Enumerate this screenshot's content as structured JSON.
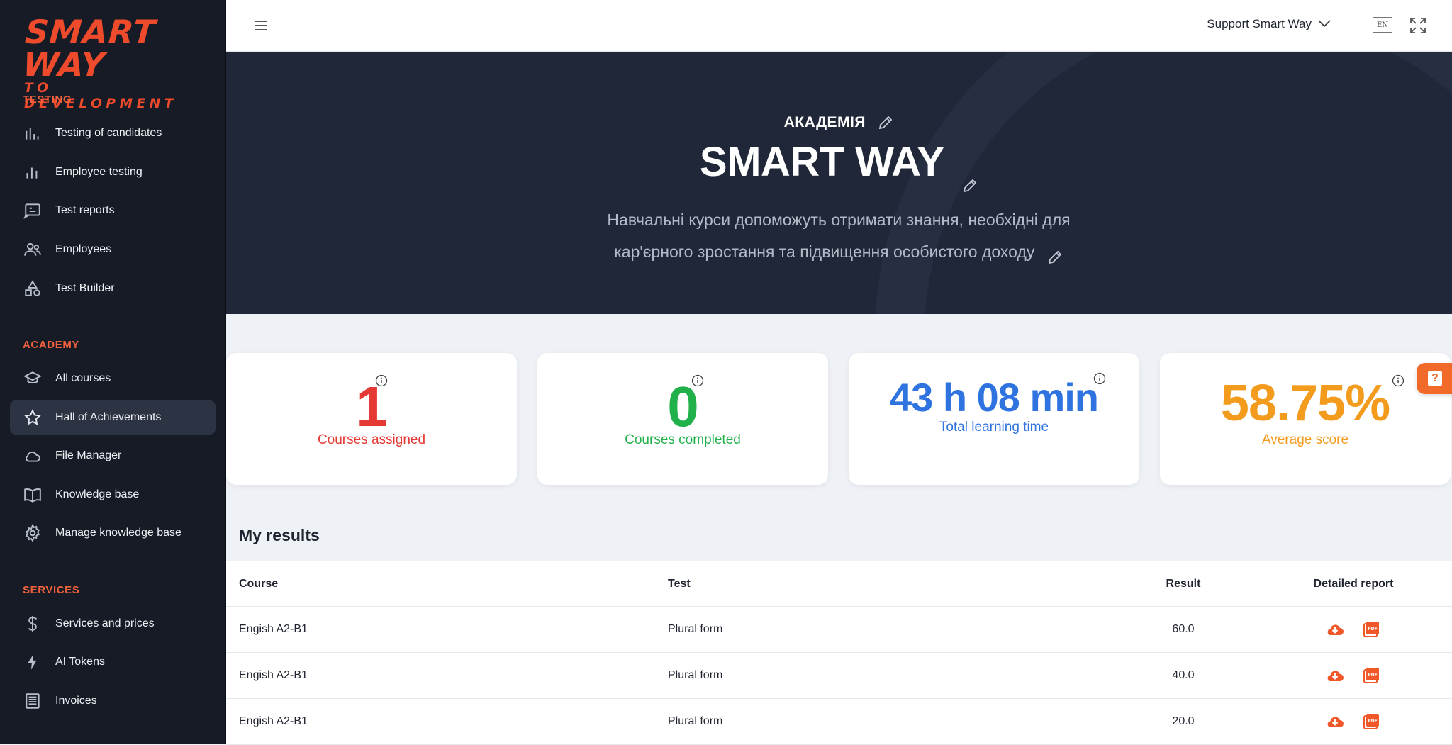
{
  "logo": {
    "line1": "SMART WAY",
    "line2": "TO DEVELOPMENT"
  },
  "sidebar": {
    "sections": [
      {
        "title": "TESTING",
        "items": [
          {
            "label": "Testing of candidates",
            "icon": "bar-chart-grid-icon"
          },
          {
            "label": "Employee testing",
            "icon": "bar-chart-icon"
          },
          {
            "label": "Test reports",
            "icon": "report-icon"
          },
          {
            "label": "Employees",
            "icon": "people-icon"
          },
          {
            "label": "Test Builder",
            "icon": "shapes-icon"
          }
        ]
      },
      {
        "title": "ACADEMY",
        "items": [
          {
            "label": "All courses",
            "icon": "graduation-cap-icon"
          },
          {
            "label": "Hall of Achievements",
            "icon": "star-icon",
            "active": true
          },
          {
            "label": "File Manager",
            "icon": "cloud-icon"
          },
          {
            "label": "Knowledge base",
            "icon": "book-icon"
          },
          {
            "label": "Manage knowledge base",
            "icon": "gear-icon"
          }
        ]
      },
      {
        "title": "SERVICES",
        "items": [
          {
            "label": "Services and prices",
            "icon": "dollar-icon"
          },
          {
            "label": "AI Tokens",
            "icon": "lightning-icon"
          },
          {
            "label": "Invoices",
            "icon": "invoice-icon"
          }
        ]
      }
    ]
  },
  "topbar": {
    "support_label": "Support Smart Way",
    "lang": "EN"
  },
  "hero": {
    "kicker": "АКАДЕМІЯ",
    "title": "SMART WAY",
    "desc_line1": "Навчальні курси допоможуть отримати знання, необхідні для",
    "desc_line2": "кар'єрного зростання та підвищення особистого доходу"
  },
  "stats": [
    {
      "value": "1",
      "caption": "Courses assigned",
      "color": "#e53935"
    },
    {
      "value": "0",
      "caption": "Courses completed",
      "color": "#22b04b"
    },
    {
      "value": "43 h 08 min",
      "caption": "Total learning time",
      "color": "#2f73e0"
    },
    {
      "value": "58.75%",
      "caption": "Average score",
      "color": "#f29b1d"
    }
  ],
  "results": {
    "title": "My results",
    "headers": {
      "course": "Course",
      "test": "Test",
      "result": "Result",
      "report": "Detailed report"
    },
    "rows": [
      {
        "course": "Engish A2-B1",
        "test": "Plural form",
        "result": "60.0"
      },
      {
        "course": "Engish A2-B1",
        "test": "Plural form",
        "result": "40.0"
      },
      {
        "course": "Engish A2-B1",
        "test": "Plural form",
        "result": "20.0"
      }
    ]
  },
  "colors": {
    "accent": "#ee4a2c",
    "sidebar_bg": "#161b26",
    "hero_bg": "#1f2738",
    "icon_orange": "#f0582a"
  }
}
